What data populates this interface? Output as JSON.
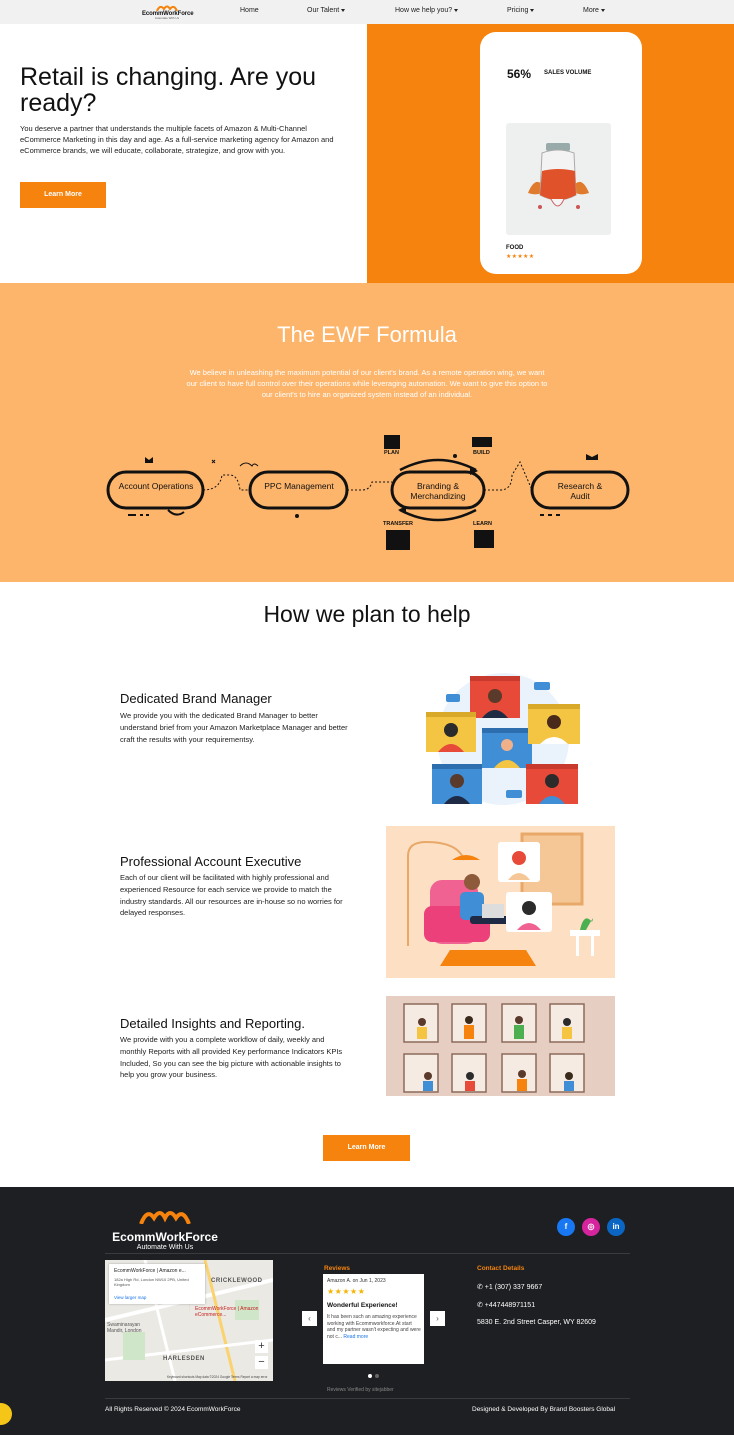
{
  "nav": {
    "logo_brand": "EcommWorkForce",
    "logo_tagline": "Automate With Us",
    "items": [
      {
        "label": "Home",
        "dropdown": false
      },
      {
        "label": "Our Talent",
        "dropdown": true
      },
      {
        "label": "How we help you?",
        "dropdown": true
      },
      {
        "label": "Pricing",
        "dropdown": true
      },
      {
        "label": "More",
        "dropdown": true
      }
    ]
  },
  "hero": {
    "title": "Retail is changing. Are you ready?",
    "text": "You deserve a partner that understands the multiple facets of Amazon & Multi-Channel eCommerce Marketing in this day and age. As a full-service marketing agency for Amazon and eCommerce brands, we will educate, collaborate, strategize, and grow with you.",
    "button": "Learn More",
    "phone": {
      "stat_value": "56%",
      "stat_label": "SALES VOLUME",
      "product_name": "FOOD",
      "stars": "★★★★★"
    }
  },
  "formula": {
    "title": "The EWF Formula",
    "text": "We believe in unleashing the maximum potential of our client's brand. As a remote operation wing, we want our client to have full control over their operations while leveraging automation. We want to give this option to our client's to hire an organized system instead of an individual.",
    "pills": [
      "Account Operations",
      "PPC Management",
      "Branding & Merchandizing",
      "Research & Audit"
    ],
    "steps": [
      "PLAN",
      "BUILD",
      "TRANSFER",
      "LEARN"
    ]
  },
  "help": {
    "title": "How we plan to help",
    "features": [
      {
        "title": "Dedicated Brand Manager",
        "text": "We provide you with the dedicated Brand Manager to better understand brief from your Amazon Marketplace Manager and better craft the results with your requirementsy."
      },
      {
        "title": "Professional Account Executive",
        "text": "Each of our client will be facilitated with highly professional and experienced Resource for each service we provide to match the industry standards. All our resources are in-house so no worries for delayed responses."
      },
      {
        "title": "Detailed Insights and Reporting.",
        "text": "We provide with you a complete workflow of daily, weekly and monthly Reports with all provided Key performance Indicators KPIs Included, So you can see the big picture with actionable insights to help you grow your business."
      }
    ],
    "button": "Learn More"
  },
  "footer": {
    "brand": "EcommWorkForce",
    "tagline": "Automate With Us",
    "social": [
      {
        "name": "facebook-icon",
        "glyph": "f",
        "color": "#1877f2"
      },
      {
        "name": "instagram-icon",
        "glyph": "◎",
        "color": "#d6249f"
      },
      {
        "name": "linkedin-icon",
        "glyph": "in",
        "color": "#0a66c2"
      }
    ],
    "map": {
      "title": "EcommWorkForce | Amazon e...",
      "address": "182a High Rd, London NW10 2PB, United Kingdom",
      "link": "View larger map",
      "label_cricklewood": "CRICKLEWOOD",
      "label_harlesden": "HARLESDEN",
      "label_area": "Swaminarayan Mandir, London",
      "pin_label": "EcommWorkForce | Amazon eCommerce...",
      "zoom_in": "+",
      "zoom_out": "−",
      "footer": "Keyboard shortcuts   Map data ©2024 Google   Terms   Report a map error"
    },
    "reviews": {
      "heading": "Reviews",
      "author": "Amazon A. on Jun 1, 2023",
      "stars": "★★★★★",
      "title": "Wonderful Experience!",
      "body": "It has been such an amazing experience working with Ecommworkforce.At start and my partner wasn't expecting and were not c...",
      "read_more": "Read more",
      "prev": "‹",
      "next": "›",
      "verified": "Reviews Verified by sitejabber"
    },
    "contact": {
      "heading": "Contact Details",
      "phone": "✆ +1 (307) 337 9667",
      "whatsapp": "✆ +447448971151",
      "address": "5830 E. 2nd Street Casper, WY 82609"
    },
    "copyright": "All Rights Reserved © 2024 EcommWorkForce",
    "credit": "Designed & Developed By Brand Boosters Global"
  },
  "colors": {
    "accent": "#f5830d",
    "formula_bg": "#fdb56b",
    "footer_bg": "#1e1f22"
  }
}
